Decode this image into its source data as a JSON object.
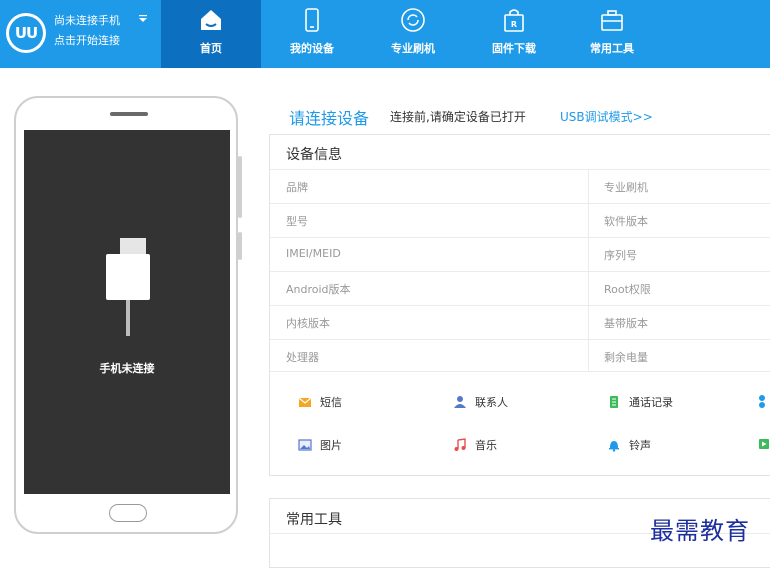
{
  "header": {
    "status": "尚未连接手机",
    "hint": "点击开始连接",
    "dropdown_icon": "chevron-down-icon",
    "logo_text": "UU",
    "nav": [
      {
        "label": "首页",
        "icon": "home-icon",
        "active": true
      },
      {
        "label": "我的设备",
        "icon": "phone-icon",
        "active": false
      },
      {
        "label": "专业刷机",
        "icon": "refresh-icon",
        "active": false
      },
      {
        "label": "固件下载",
        "icon": "rom-bag-icon",
        "active": false
      },
      {
        "label": "常用工具",
        "icon": "toolbox-icon",
        "active": false
      }
    ]
  },
  "phone": {
    "status_label": "手机未连接"
  },
  "connect": {
    "title": "请连接设备",
    "hint": "连接前,请确定设备已打开",
    "usb_link": "USB调试模式>>"
  },
  "device_info": {
    "title": "设备信息",
    "rows": [
      {
        "left": "品牌",
        "right": "专业刷机"
      },
      {
        "left": "型号",
        "right": "软件版本"
      },
      {
        "left": "IMEI/MEID",
        "right": "序列号"
      },
      {
        "left": "Android版本",
        "right": "Root权限"
      },
      {
        "left": "内核版本",
        "right": "基带版本"
      },
      {
        "left": "处理器",
        "right": "剩余电量"
      }
    ]
  },
  "quick": [
    {
      "label": "短信",
      "icon": "sms-icon"
    },
    {
      "label": "联系人",
      "icon": "contact-icon"
    },
    {
      "label": "通话记录",
      "icon": "call-log-icon"
    },
    {
      "label": "图片",
      "icon": "image-icon"
    },
    {
      "label": "音乐",
      "icon": "music-icon"
    },
    {
      "label": "铃声",
      "icon": "bell-icon"
    }
  ],
  "tools": {
    "title": "常用工具"
  },
  "watermark": "最需教育",
  "colors": {
    "header": "#1e9ae8",
    "active_tab": "#0c6fc0",
    "screen": "#333333",
    "link": "#1e9ae8"
  }
}
